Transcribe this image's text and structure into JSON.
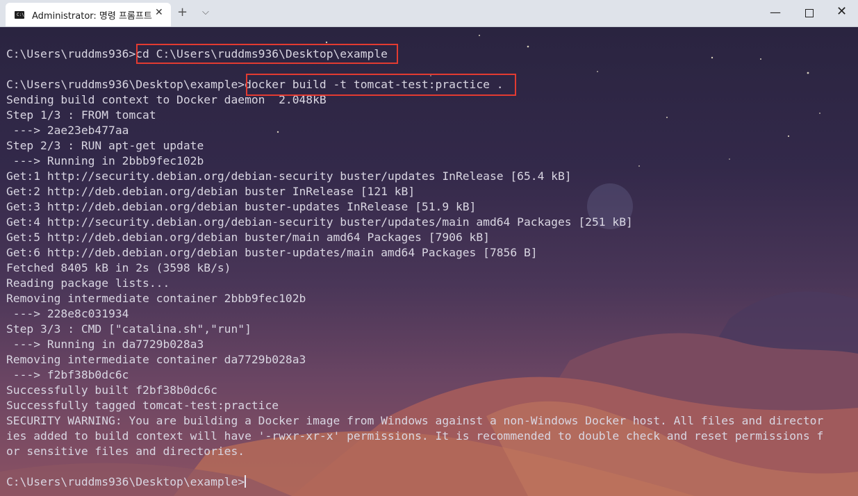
{
  "window": {
    "tab_title": "Administrator: 명령 프롬프트",
    "tab_icon": "cmd-icon",
    "controls": {
      "new_tab": "+",
      "dropdown": "⌵",
      "minimize": "—",
      "close": "✕"
    }
  },
  "terminal": {
    "lines": [
      "",
      "C:\\Users\\ruddms936>cd C:\\Users\\ruddms936\\Desktop\\example",
      "",
      "C:\\Users\\ruddms936\\Desktop\\example>docker build -t tomcat-test:practice .",
      "Sending build context to Docker daemon  2.048kB",
      "Step 1/3 : FROM tomcat",
      " ---> 2ae23eb477aa",
      "Step 2/3 : RUN apt-get update",
      " ---> Running in 2bbb9fec102b",
      "Get:1 http://security.debian.org/debian-security buster/updates InRelease [65.4 kB]",
      "Get:2 http://deb.debian.org/debian buster InRelease [121 kB]",
      "Get:3 http://deb.debian.org/debian buster-updates InRelease [51.9 kB]",
      "Get:4 http://security.debian.org/debian-security buster/updates/main amd64 Packages [251 kB]",
      "Get:5 http://deb.debian.org/debian buster/main amd64 Packages [7906 kB]",
      "Get:6 http://deb.debian.org/debian buster-updates/main amd64 Packages [7856 B]",
      "Fetched 8405 kB in 2s (3598 kB/s)",
      "Reading package lists...",
      "Removing intermediate container 2bbb9fec102b",
      " ---> 228e8c031934",
      "Step 3/3 : CMD [\"catalina.sh\",\"run\"]",
      " ---> Running in da7729b028a3",
      "Removing intermediate container da7729b028a3",
      " ---> f2bf38b0dc6c",
      "Successfully built f2bf38b0dc6c",
      "Successfully tagged tomcat-test:practice",
      "SECURITY WARNING: You are building a Docker image from Windows against a non-Windows Docker host. All files and director",
      "ies added to build context will have '-rwxr-xr-x' permissions. It is recommended to double check and reset permissions f",
      "or sensitive files and directories.",
      ""
    ],
    "prompt": "C:\\Users\\ruddms936\\Desktop\\example>",
    "colors": {
      "foreground": "#d9d6e2",
      "highlight_box": "#e33b31"
    }
  }
}
